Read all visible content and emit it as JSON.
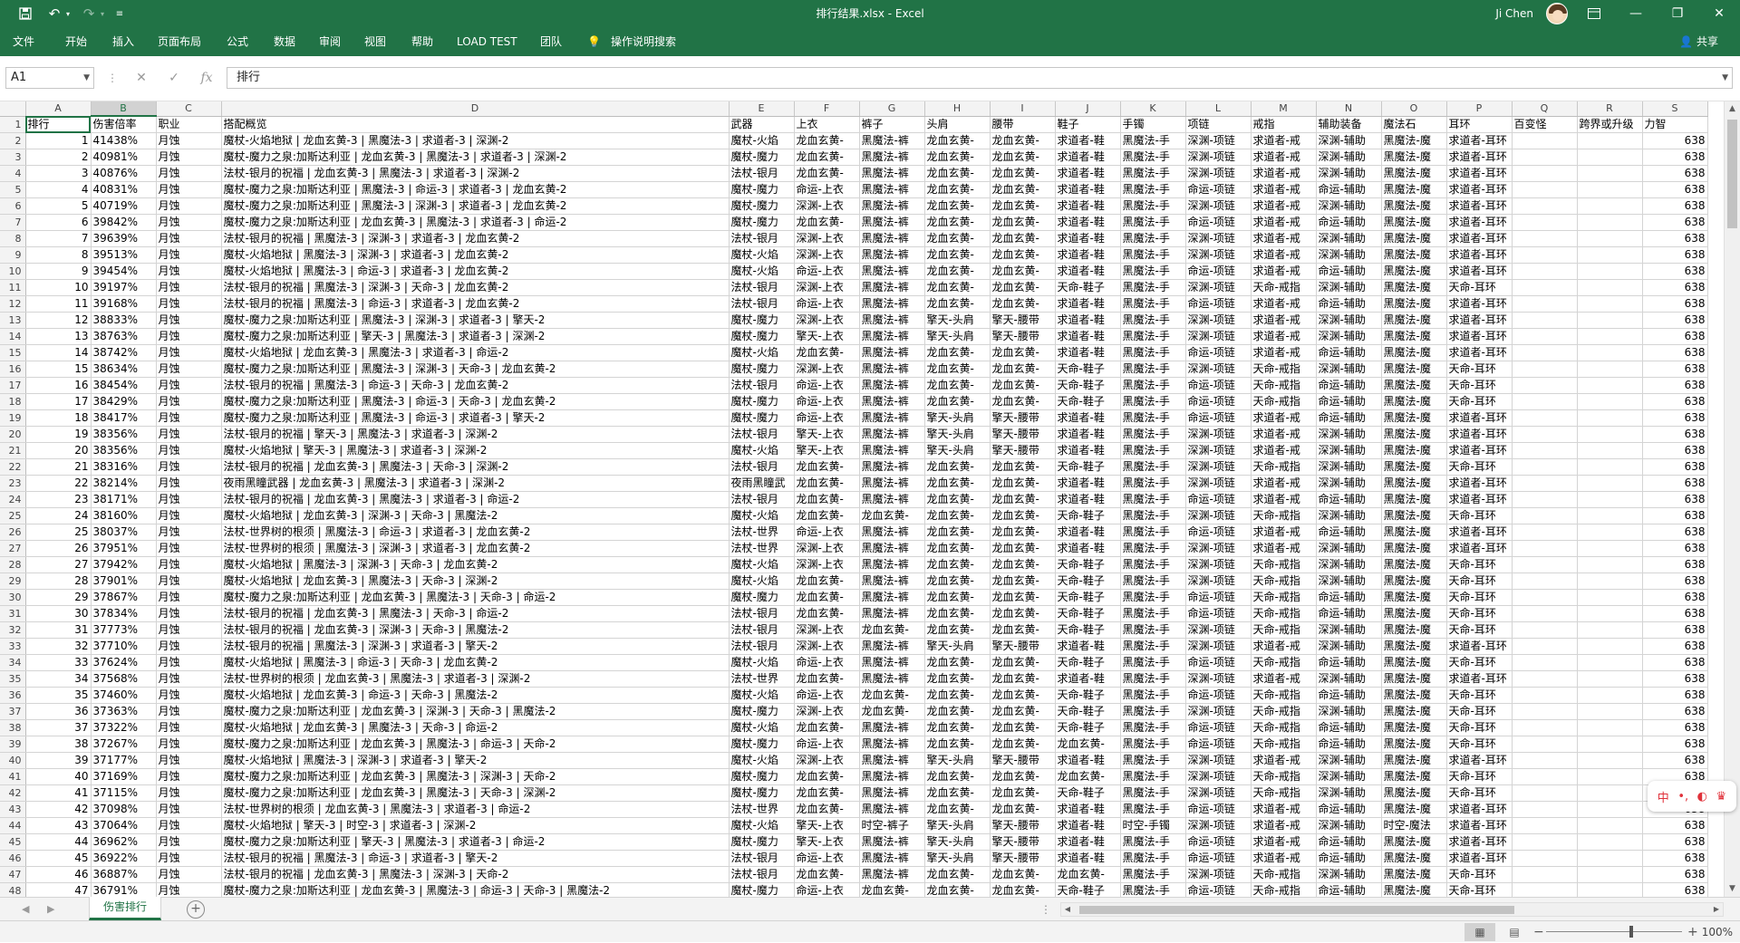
{
  "window": {
    "title": "排行结果.xlsx - Excel",
    "user": "Ji Chen",
    "accent_color": "#217346"
  },
  "menu": {
    "items": [
      "文件",
      "开始",
      "插入",
      "页面布局",
      "公式",
      "数据",
      "审阅",
      "视图",
      "帮助",
      "LOAD TEST",
      "团队",
      "操作说明搜索"
    ],
    "share": "共享"
  },
  "formula_bar": {
    "name_box": "A1",
    "content": "排行"
  },
  "sheet": {
    "columns": [
      "A",
      "B",
      "C",
      "D",
      "E",
      "F",
      "G",
      "H",
      "I",
      "J",
      "K",
      "L",
      "M",
      "N",
      "O",
      "P",
      "Q",
      "R",
      "S"
    ],
    "header_row": [
      "排行",
      "伤害倍率",
      "职业",
      "搭配概览",
      "武器",
      "上衣",
      "裤子",
      "头肩",
      "腰带",
      "鞋子",
      "手镯",
      "项链",
      "戒指",
      "辅助装备",
      "魔法石",
      "耳环",
      "百变怪",
      "跨界或升级",
      "力智"
    ],
    "rows": [
      [
        "1",
        "41438%",
        "月蚀",
        "魔杖-火焰地狱 | 龙血玄黄-3 | 黑魔法-3 | 求道者-3 | 深渊-2",
        "魔杖-火焰",
        "龙血玄黄-",
        "黑魔法-裤",
        "龙血玄黄-",
        "龙血玄黄-",
        "求道者-鞋",
        "黑魔法-手",
        "深渊-项链",
        "求道者-戒",
        "深渊-辅助",
        "黑魔法-魔",
        "求道者-耳环",
        "",
        "",
        "638"
      ],
      [
        "2",
        "40981%",
        "月蚀",
        "魔杖-魔力之泉:加斯达利亚 | 龙血玄黄-3 | 黑魔法-3 | 求道者-3 | 深渊-2",
        "魔杖-魔力",
        "龙血玄黄-",
        "黑魔法-裤",
        "龙血玄黄-",
        "龙血玄黄-",
        "求道者-鞋",
        "黑魔法-手",
        "深渊-项链",
        "求道者-戒",
        "深渊-辅助",
        "黑魔法-魔",
        "求道者-耳环",
        "",
        "",
        "638"
      ],
      [
        "3",
        "40876%",
        "月蚀",
        "法杖-银月的祝福 | 龙血玄黄-3 | 黑魔法-3 | 求道者-3 | 深渊-2",
        "法杖-银月",
        "龙血玄黄-",
        "黑魔法-裤",
        "龙血玄黄-",
        "龙血玄黄-",
        "求道者-鞋",
        "黑魔法-手",
        "深渊-项链",
        "求道者-戒",
        "深渊-辅助",
        "黑魔法-魔",
        "求道者-耳环",
        "",
        "",
        "638"
      ],
      [
        "4",
        "40831%",
        "月蚀",
        "魔杖-魔力之泉:加斯达利亚 | 黑魔法-3 | 命运-3 | 求道者-3 | 龙血玄黄-2",
        "魔杖-魔力",
        "命运-上衣",
        "黑魔法-裤",
        "龙血玄黄-",
        "龙血玄黄-",
        "求道者-鞋",
        "黑魔法-手",
        "命运-项链",
        "求道者-戒",
        "命运-辅助",
        "黑魔法-魔",
        "求道者-耳环",
        "",
        "",
        "638"
      ],
      [
        "5",
        "40719%",
        "月蚀",
        "魔杖-魔力之泉:加斯达利亚 | 黑魔法-3 | 深渊-3 | 求道者-3 | 龙血玄黄-2",
        "魔杖-魔力",
        "深渊-上衣",
        "黑魔法-裤",
        "龙血玄黄-",
        "龙血玄黄-",
        "求道者-鞋",
        "黑魔法-手",
        "深渊-项链",
        "求道者-戒",
        "深渊-辅助",
        "黑魔法-魔",
        "求道者-耳环",
        "",
        "",
        "638"
      ],
      [
        "6",
        "39842%",
        "月蚀",
        "魔杖-魔力之泉:加斯达利亚 | 龙血玄黄-3 | 黑魔法-3 | 求道者-3 | 命运-2",
        "魔杖-魔力",
        "龙血玄黄-",
        "黑魔法-裤",
        "龙血玄黄-",
        "龙血玄黄-",
        "求道者-鞋",
        "黑魔法-手",
        "命运-项链",
        "求道者-戒",
        "命运-辅助",
        "黑魔法-魔",
        "求道者-耳环",
        "",
        "",
        "638"
      ],
      [
        "7",
        "39639%",
        "月蚀",
        "法杖-银月的祝福 | 黑魔法-3 | 深渊-3 | 求道者-3 | 龙血玄黄-2",
        "法杖-银月",
        "深渊-上衣",
        "黑魔法-裤",
        "龙血玄黄-",
        "龙血玄黄-",
        "求道者-鞋",
        "黑魔法-手",
        "深渊-项链",
        "求道者-戒",
        "深渊-辅助",
        "黑魔法-魔",
        "求道者-耳环",
        "",
        "",
        "638"
      ],
      [
        "8",
        "39513%",
        "月蚀",
        "魔杖-火焰地狱 | 黑魔法-3 | 深渊-3 | 求道者-3 | 龙血玄黄-2",
        "魔杖-火焰",
        "深渊-上衣",
        "黑魔法-裤",
        "龙血玄黄-",
        "龙血玄黄-",
        "求道者-鞋",
        "黑魔法-手",
        "深渊-项链",
        "求道者-戒",
        "深渊-辅助",
        "黑魔法-魔",
        "求道者-耳环",
        "",
        "",
        "638"
      ],
      [
        "9",
        "39454%",
        "月蚀",
        "魔杖-火焰地狱 | 黑魔法-3 | 命运-3 | 求道者-3 | 龙血玄黄-2",
        "魔杖-火焰",
        "命运-上衣",
        "黑魔法-裤",
        "龙血玄黄-",
        "龙血玄黄-",
        "求道者-鞋",
        "黑魔法-手",
        "命运-项链",
        "求道者-戒",
        "命运-辅助",
        "黑魔法-魔",
        "求道者-耳环",
        "",
        "",
        "638"
      ],
      [
        "10",
        "39197%",
        "月蚀",
        "法杖-银月的祝福 | 黑魔法-3 | 深渊-3 | 天命-3 | 龙血玄黄-2",
        "法杖-银月",
        "深渊-上衣",
        "黑魔法-裤",
        "龙血玄黄-",
        "龙血玄黄-",
        "天命-鞋子",
        "黑魔法-手",
        "深渊-项链",
        "天命-戒指",
        "深渊-辅助",
        "黑魔法-魔",
        "天命-耳环",
        "",
        "",
        "638"
      ],
      [
        "11",
        "39168%",
        "月蚀",
        "法杖-银月的祝福 | 黑魔法-3 | 命运-3 | 求道者-3 | 龙血玄黄-2",
        "法杖-银月",
        "命运-上衣",
        "黑魔法-裤",
        "龙血玄黄-",
        "龙血玄黄-",
        "求道者-鞋",
        "黑魔法-手",
        "命运-项链",
        "求道者-戒",
        "命运-辅助",
        "黑魔法-魔",
        "求道者-耳环",
        "",
        "",
        "638"
      ],
      [
        "12",
        "38833%",
        "月蚀",
        "魔杖-魔力之泉:加斯达利亚 | 黑魔法-3 | 深渊-3 | 求道者-3 | 擎天-2",
        "魔杖-魔力",
        "深渊-上衣",
        "黑魔法-裤",
        "擎天-头肩",
        "擎天-腰带",
        "求道者-鞋",
        "黑魔法-手",
        "深渊-项链",
        "求道者-戒",
        "深渊-辅助",
        "黑魔法-魔",
        "求道者-耳环",
        "",
        "",
        "638"
      ],
      [
        "13",
        "38763%",
        "月蚀",
        "魔杖-魔力之泉:加斯达利亚 | 擎天-3 | 黑魔法-3 | 求道者-3 | 深渊-2",
        "魔杖-魔力",
        "擎天-上衣",
        "黑魔法-裤",
        "擎天-头肩",
        "擎天-腰带",
        "求道者-鞋",
        "黑魔法-手",
        "深渊-项链",
        "求道者-戒",
        "深渊-辅助",
        "黑魔法-魔",
        "求道者-耳环",
        "",
        "",
        "638"
      ],
      [
        "14",
        "38742%",
        "月蚀",
        "魔杖-火焰地狱 | 龙血玄黄-3 | 黑魔法-3 | 求道者-3 | 命运-2",
        "魔杖-火焰",
        "龙血玄黄-",
        "黑魔法-裤",
        "龙血玄黄-",
        "龙血玄黄-",
        "求道者-鞋",
        "黑魔法-手",
        "命运-项链",
        "求道者-戒",
        "命运-辅助",
        "黑魔法-魔",
        "求道者-耳环",
        "",
        "",
        "638"
      ],
      [
        "15",
        "38634%",
        "月蚀",
        "魔杖-魔力之泉:加斯达利亚 | 黑魔法-3 | 深渊-3 | 天命-3 | 龙血玄黄-2",
        "魔杖-魔力",
        "深渊-上衣",
        "黑魔法-裤",
        "龙血玄黄-",
        "龙血玄黄-",
        "天命-鞋子",
        "黑魔法-手",
        "深渊-项链",
        "天命-戒指",
        "深渊-辅助",
        "黑魔法-魔",
        "天命-耳环",
        "",
        "",
        "638"
      ],
      [
        "16",
        "38454%",
        "月蚀",
        "法杖-银月的祝福 | 黑魔法-3 | 命运-3 | 天命-3 | 龙血玄黄-2",
        "法杖-银月",
        "命运-上衣",
        "黑魔法-裤",
        "龙血玄黄-",
        "龙血玄黄-",
        "天命-鞋子",
        "黑魔法-手",
        "命运-项链",
        "天命-戒指",
        "命运-辅助",
        "黑魔法-魔",
        "天命-耳环",
        "",
        "",
        "638"
      ],
      [
        "17",
        "38429%",
        "月蚀",
        "魔杖-魔力之泉:加斯达利亚 | 黑魔法-3 | 命运-3 | 天命-3 | 龙血玄黄-2",
        "魔杖-魔力",
        "命运-上衣",
        "黑魔法-裤",
        "龙血玄黄-",
        "龙血玄黄-",
        "天命-鞋子",
        "黑魔法-手",
        "命运-项链",
        "天命-戒指",
        "命运-辅助",
        "黑魔法-魔",
        "天命-耳环",
        "",
        "",
        "638"
      ],
      [
        "18",
        "38417%",
        "月蚀",
        "魔杖-魔力之泉:加斯达利亚 | 黑魔法-3 | 命运-3 | 求道者-3 | 擎天-2",
        "魔杖-魔力",
        "命运-上衣",
        "黑魔法-裤",
        "擎天-头肩",
        "擎天-腰带",
        "求道者-鞋",
        "黑魔法-手",
        "命运-项链",
        "求道者-戒",
        "命运-辅助",
        "黑魔法-魔",
        "求道者-耳环",
        "",
        "",
        "638"
      ],
      [
        "19",
        "38356%",
        "月蚀",
        "法杖-银月的祝福 | 擎天-3 | 黑魔法-3 | 求道者-3 | 深渊-2",
        "法杖-银月",
        "擎天-上衣",
        "黑魔法-裤",
        "擎天-头肩",
        "擎天-腰带",
        "求道者-鞋",
        "黑魔法-手",
        "深渊-项链",
        "求道者-戒",
        "深渊-辅助",
        "黑魔法-魔",
        "求道者-耳环",
        "",
        "",
        "638"
      ],
      [
        "20",
        "38356%",
        "月蚀",
        "魔杖-火焰地狱 | 擎天-3 | 黑魔法-3 | 求道者-3 | 深渊-2",
        "魔杖-火焰",
        "擎天-上衣",
        "黑魔法-裤",
        "擎天-头肩",
        "擎天-腰带",
        "求道者-鞋",
        "黑魔法-手",
        "深渊-项链",
        "求道者-戒",
        "深渊-辅助",
        "黑魔法-魔",
        "求道者-耳环",
        "",
        "",
        "638"
      ],
      [
        "21",
        "38316%",
        "月蚀",
        "法杖-银月的祝福 | 龙血玄黄-3 | 黑魔法-3 | 天命-3 | 深渊-2",
        "法杖-银月",
        "龙血玄黄-",
        "黑魔法-裤",
        "龙血玄黄-",
        "龙血玄黄-",
        "天命-鞋子",
        "黑魔法-手",
        "深渊-项链",
        "天命-戒指",
        "深渊-辅助",
        "黑魔法-魔",
        "天命-耳环",
        "",
        "",
        "638"
      ],
      [
        "22",
        "38214%",
        "月蚀",
        "夜雨黑瞳武器 | 龙血玄黄-3 | 黑魔法-3 | 求道者-3 | 深渊-2",
        "夜雨黑瞳武",
        "龙血玄黄-",
        "黑魔法-裤",
        "龙血玄黄-",
        "龙血玄黄-",
        "求道者-鞋",
        "黑魔法-手",
        "深渊-项链",
        "求道者-戒",
        "深渊-辅助",
        "黑魔法-魔",
        "求道者-耳环",
        "",
        "",
        "638"
      ],
      [
        "23",
        "38171%",
        "月蚀",
        "法杖-银月的祝福 | 龙血玄黄-3 | 黑魔法-3 | 求道者-3 | 命运-2",
        "法杖-银月",
        "龙血玄黄-",
        "黑魔法-裤",
        "龙血玄黄-",
        "龙血玄黄-",
        "求道者-鞋",
        "黑魔法-手",
        "命运-项链",
        "求道者-戒",
        "命运-辅助",
        "黑魔法-魔",
        "求道者-耳环",
        "",
        "",
        "638"
      ],
      [
        "24",
        "38160%",
        "月蚀",
        "魔杖-火焰地狱 | 龙血玄黄-3 | 深渊-3 | 天命-3 | 黑魔法-2",
        "魔杖-火焰",
        "龙血玄黄-",
        "龙血玄黄-",
        "龙血玄黄-",
        "龙血玄黄-",
        "天命-鞋子",
        "黑魔法-手",
        "深渊-项链",
        "天命-戒指",
        "深渊-辅助",
        "黑魔法-魔",
        "天命-耳环",
        "",
        "",
        "638"
      ],
      [
        "25",
        "38037%",
        "月蚀",
        "法杖-世界树的根须 | 黑魔法-3 | 命运-3 | 求道者-3 | 龙血玄黄-2",
        "法杖-世界",
        "命运-上衣",
        "黑魔法-裤",
        "龙血玄黄-",
        "龙血玄黄-",
        "求道者-鞋",
        "黑魔法-手",
        "命运-项链",
        "求道者-戒",
        "命运-辅助",
        "黑魔法-魔",
        "求道者-耳环",
        "",
        "",
        "638"
      ],
      [
        "26",
        "37951%",
        "月蚀",
        "法杖-世界树的根须 | 黑魔法-3 | 深渊-3 | 求道者-3 | 龙血玄黄-2",
        "法杖-世界",
        "深渊-上衣",
        "黑魔法-裤",
        "龙血玄黄-",
        "龙血玄黄-",
        "求道者-鞋",
        "黑魔法-手",
        "深渊-项链",
        "求道者-戒",
        "深渊-辅助",
        "黑魔法-魔",
        "求道者-耳环",
        "",
        "",
        "638"
      ],
      [
        "27",
        "37942%",
        "月蚀",
        "魔杖-火焰地狱 | 黑魔法-3 | 深渊-3 | 天命-3 | 龙血玄黄-2",
        "魔杖-火焰",
        "深渊-上衣",
        "黑魔法-裤",
        "龙血玄黄-",
        "龙血玄黄-",
        "天命-鞋子",
        "黑魔法-手",
        "深渊-项链",
        "天命-戒指",
        "深渊-辅助",
        "黑魔法-魔",
        "天命-耳环",
        "",
        "",
        "638"
      ],
      [
        "28",
        "37901%",
        "月蚀",
        "魔杖-火焰地狱 | 龙血玄黄-3 | 黑魔法-3 | 天命-3 | 深渊-2",
        "魔杖-火焰",
        "龙血玄黄-",
        "黑魔法-裤",
        "龙血玄黄-",
        "龙血玄黄-",
        "天命-鞋子",
        "黑魔法-手",
        "深渊-项链",
        "天命-戒指",
        "深渊-辅助",
        "黑魔法-魔",
        "天命-耳环",
        "",
        "",
        "638"
      ],
      [
        "29",
        "37867%",
        "月蚀",
        "魔杖-魔力之泉:加斯达利亚 | 龙血玄黄-3 | 黑魔法-3 | 天命-3 | 命运-2",
        "魔杖-魔力",
        "龙血玄黄-",
        "黑魔法-裤",
        "龙血玄黄-",
        "龙血玄黄-",
        "天命-鞋子",
        "黑魔法-手",
        "命运-项链",
        "天命-戒指",
        "命运-辅助",
        "黑魔法-魔",
        "天命-耳环",
        "",
        "",
        "638"
      ],
      [
        "30",
        "37834%",
        "月蚀",
        "法杖-银月的祝福 | 龙血玄黄-3 | 黑魔法-3 | 天命-3 | 命运-2",
        "法杖-银月",
        "龙血玄黄-",
        "黑魔法-裤",
        "龙血玄黄-",
        "龙血玄黄-",
        "天命-鞋子",
        "黑魔法-手",
        "命运-项链",
        "天命-戒指",
        "命运-辅助",
        "黑魔法-魔",
        "天命-耳环",
        "",
        "",
        "638"
      ],
      [
        "31",
        "37773%",
        "月蚀",
        "法杖-银月的祝福 | 龙血玄黄-3 | 深渊-3 | 天命-3 | 黑魔法-2",
        "法杖-银月",
        "深渊-上衣",
        "龙血玄黄-",
        "龙血玄黄-",
        "龙血玄黄-",
        "天命-鞋子",
        "黑魔法-手",
        "深渊-项链",
        "天命-戒指",
        "深渊-辅助",
        "黑魔法-魔",
        "天命-耳环",
        "",
        "",
        "638"
      ],
      [
        "32",
        "37710%",
        "月蚀",
        "法杖-银月的祝福 | 黑魔法-3 | 深渊-3 | 求道者-3 | 擎天-2",
        "法杖-银月",
        "深渊-上衣",
        "黑魔法-裤",
        "擎天-头肩",
        "擎天-腰带",
        "求道者-鞋",
        "黑魔法-手",
        "深渊-项链",
        "求道者-戒",
        "深渊-辅助",
        "黑魔法-魔",
        "求道者-耳环",
        "",
        "",
        "638"
      ],
      [
        "33",
        "37624%",
        "月蚀",
        "魔杖-火焰地狱 | 黑魔法-3 | 命运-3 | 天命-3 | 龙血玄黄-2",
        "魔杖-火焰",
        "命运-上衣",
        "黑魔法-裤",
        "龙血玄黄-",
        "龙血玄黄-",
        "天命-鞋子",
        "黑魔法-手",
        "命运-项链",
        "天命-戒指",
        "命运-辅助",
        "黑魔法-魔",
        "天命-耳环",
        "",
        "",
        "638"
      ],
      [
        "34",
        "37568%",
        "月蚀",
        "法杖-世界树的根须 | 龙血玄黄-3 | 黑魔法-3 | 求道者-3 | 深渊-2",
        "法杖-世界",
        "龙血玄黄-",
        "黑魔法-裤",
        "龙血玄黄-",
        "龙血玄黄-",
        "求道者-鞋",
        "黑魔法-手",
        "深渊-项链",
        "求道者-戒",
        "深渊-辅助",
        "黑魔法-魔",
        "求道者-耳环",
        "",
        "",
        "638"
      ],
      [
        "35",
        "37460%",
        "月蚀",
        "魔杖-火焰地狱 | 龙血玄黄-3 | 命运-3 | 天命-3 | 黑魔法-2",
        "魔杖-火焰",
        "命运-上衣",
        "龙血玄黄-",
        "龙血玄黄-",
        "龙血玄黄-",
        "天命-鞋子",
        "黑魔法-手",
        "命运-项链",
        "天命-戒指",
        "命运-辅助",
        "黑魔法-魔",
        "天命-耳环",
        "",
        "",
        "638"
      ],
      [
        "36",
        "37363%",
        "月蚀",
        "魔杖-魔力之泉:加斯达利亚 | 龙血玄黄-3 | 深渊-3 | 天命-3 | 黑魔法-2",
        "魔杖-魔力",
        "深渊-上衣",
        "龙血玄黄-",
        "龙血玄黄-",
        "龙血玄黄-",
        "天命-鞋子",
        "黑魔法-手",
        "深渊-项链",
        "天命-戒指",
        "深渊-辅助",
        "黑魔法-魔",
        "天命-耳环",
        "",
        "",
        "638"
      ],
      [
        "37",
        "37322%",
        "月蚀",
        "魔杖-火焰地狱 | 龙血玄黄-3 | 黑魔法-3 | 天命-3 | 命运-2",
        "魔杖-火焰",
        "龙血玄黄-",
        "黑魔法-裤",
        "龙血玄黄-",
        "龙血玄黄-",
        "天命-鞋子",
        "黑魔法-手",
        "命运-项链",
        "天命-戒指",
        "命运-辅助",
        "黑魔法-魔",
        "天命-耳环",
        "",
        "",
        "638"
      ],
      [
        "38",
        "37267%",
        "月蚀",
        "魔杖-魔力之泉:加斯达利亚 | 龙血玄黄-3 | 黑魔法-3 | 命运-3 | 天命-2",
        "魔杖-魔力",
        "命运-上衣",
        "黑魔法-裤",
        "龙血玄黄-",
        "龙血玄黄-",
        "龙血玄黄-",
        "黑魔法-手",
        "命运-项链",
        "天命-戒指",
        "命运-辅助",
        "黑魔法-魔",
        "天命-耳环",
        "",
        "",
        "638"
      ],
      [
        "39",
        "37177%",
        "月蚀",
        "魔杖-火焰地狱 | 黑魔法-3 | 深渊-3 | 求道者-3 | 擎天-2",
        "魔杖-火焰",
        "深渊-上衣",
        "黑魔法-裤",
        "擎天-头肩",
        "擎天-腰带",
        "求道者-鞋",
        "黑魔法-手",
        "深渊-项链",
        "求道者-戒",
        "深渊-辅助",
        "黑魔法-魔",
        "求道者-耳环",
        "",
        "",
        "638"
      ],
      [
        "40",
        "37169%",
        "月蚀",
        "魔杖-魔力之泉:加斯达利亚 | 龙血玄黄-3 | 黑魔法-3 | 深渊-3 | 天命-2",
        "魔杖-魔力",
        "龙血玄黄-",
        "黑魔法-裤",
        "龙血玄黄-",
        "龙血玄黄-",
        "龙血玄黄-",
        "黑魔法-手",
        "深渊-项链",
        "天命-戒指",
        "深渊-辅助",
        "黑魔法-魔",
        "天命-耳环",
        "",
        "",
        "638"
      ],
      [
        "41",
        "37115%",
        "月蚀",
        "魔杖-魔力之泉:加斯达利亚 | 龙血玄黄-3 | 黑魔法-3 | 天命-3 | 深渊-2",
        "魔杖-魔力",
        "龙血玄黄-",
        "黑魔法-裤",
        "龙血玄黄-",
        "龙血玄黄-",
        "天命-鞋子",
        "黑魔法-手",
        "深渊-项链",
        "天命-戒指",
        "深渊-辅助",
        "黑魔法-魔",
        "天命-耳环",
        "",
        "",
        "638"
      ],
      [
        "42",
        "37098%",
        "月蚀",
        "法杖-世界树的根须 | 龙血玄黄-3 | 黑魔法-3 | 求道者-3 | 命运-2",
        "法杖-世界",
        "龙血玄黄-",
        "黑魔法-裤",
        "龙血玄黄-",
        "龙血玄黄-",
        "求道者-鞋",
        "黑魔法-手",
        "命运-项链",
        "求道者-戒",
        "命运-辅助",
        "黑魔法-魔",
        "求道者-耳环",
        "",
        "",
        "638"
      ],
      [
        "43",
        "37064%",
        "月蚀",
        "魔杖-火焰地狱 | 擎天-3 | 时空-3 | 求道者-3 | 深渊-2",
        "魔杖-火焰",
        "擎天-上衣",
        "时空-裤子",
        "擎天-头肩",
        "擎天-腰带",
        "求道者-鞋",
        "时空-手镯",
        "深渊-项链",
        "求道者-戒",
        "深渊-辅助",
        "时空-魔法",
        "求道者-耳环",
        "",
        "",
        "638"
      ],
      [
        "44",
        "36962%",
        "月蚀",
        "魔杖-魔力之泉:加斯达利亚 | 擎天-3 | 黑魔法-3 | 求道者-3 | 命运-2",
        "魔杖-魔力",
        "擎天-上衣",
        "黑魔法-裤",
        "擎天-头肩",
        "擎天-腰带",
        "求道者-鞋",
        "黑魔法-手",
        "命运-项链",
        "求道者-戒",
        "命运-辅助",
        "黑魔法-魔",
        "求道者-耳环",
        "",
        "",
        "638"
      ],
      [
        "45",
        "36922%",
        "月蚀",
        "法杖-银月的祝福 | 黑魔法-3 | 命运-3 | 求道者-3 | 擎天-2",
        "法杖-银月",
        "命运-上衣",
        "黑魔法-裤",
        "擎天-头肩",
        "擎天-腰带",
        "求道者-鞋",
        "黑魔法-手",
        "命运-项链",
        "求道者-戒",
        "命运-辅助",
        "黑魔法-魔",
        "求道者-耳环",
        "",
        "",
        "638"
      ],
      [
        "46",
        "36887%",
        "月蚀",
        "法杖-银月的祝福 | 龙血玄黄-3 | 黑魔法-3 | 深渊-3 | 天命-2",
        "法杖-银月",
        "龙血玄黄-",
        "黑魔法-裤",
        "龙血玄黄-",
        "龙血玄黄-",
        "龙血玄黄-",
        "黑魔法-手",
        "深渊-项链",
        "天命-戒指",
        "深渊-辅助",
        "黑魔法-魔",
        "天命-耳环",
        "",
        "",
        "638"
      ],
      [
        "47",
        "36791%",
        "月蚀",
        "魔杖-魔力之泉:加斯达利亚 | 龙血玄黄-3 | 黑魔法-3 | 命运-3 | 天命-3 | 黑魔法-2",
        "魔杖-魔力",
        "命运-上衣",
        "龙血玄黄-",
        "龙血玄黄-",
        "龙血玄黄-",
        "天命-鞋子",
        "黑魔法-手",
        "命运-项链",
        "天命-戒指",
        "命运-辅助",
        "黑魔法-魔",
        "天命-耳环",
        "",
        "",
        "638"
      ]
    ],
    "tab_name": "伤害排行"
  },
  "status": {
    "zoom": "100%",
    "zoom_level": 100
  },
  "ime": {
    "label": "中"
  }
}
